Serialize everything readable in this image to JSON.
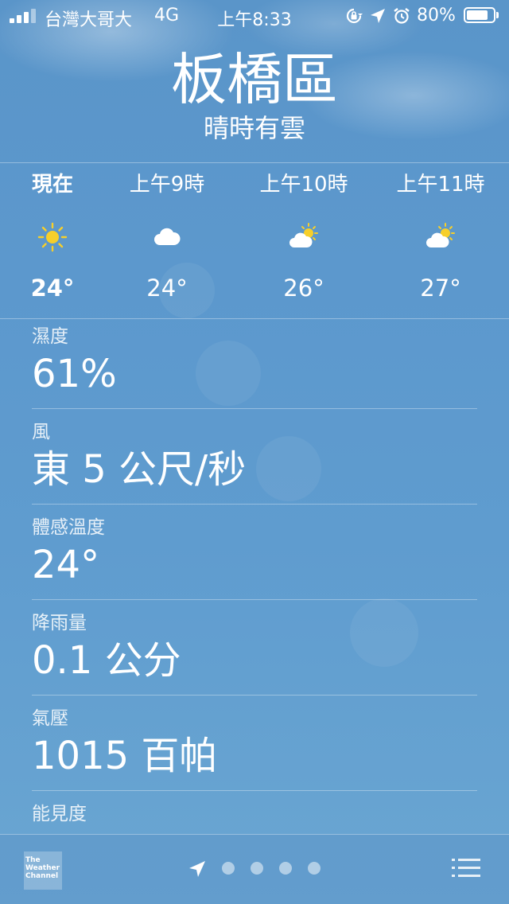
{
  "status_bar": {
    "carrier": "台灣大哥大",
    "network": "4G",
    "time": "上午8:33",
    "battery_percent": "80%",
    "battery_level": 0.8
  },
  "header": {
    "city": "板橋區",
    "condition": "晴時有雲"
  },
  "hourly": [
    {
      "label": "現在",
      "icon": "sun-icon",
      "temp": "24°"
    },
    {
      "label": "上午9時",
      "icon": "cloud-icon",
      "temp": "24°"
    },
    {
      "label": "上午10時",
      "icon": "partly-sunny-icon",
      "temp": "26°"
    },
    {
      "label": "上午11時",
      "icon": "partly-sunny-icon",
      "temp": "27°"
    }
  ],
  "details": [
    {
      "label": "濕度",
      "value": "61%"
    },
    {
      "label": "風",
      "value": "東 5 公尺/秒"
    },
    {
      "label": "體感溫度",
      "value": "24°"
    },
    {
      "label": "降雨量",
      "value": "0.1 公分"
    },
    {
      "label": "氣壓",
      "value": "1015 百帕"
    },
    {
      "label": "能見度",
      "value": ""
    }
  ],
  "bottom_bar": {
    "logo_lines": [
      "The",
      "Weather",
      "Channel"
    ],
    "page_dots": 4,
    "icons": [
      "location-arrow-icon",
      "list-icon"
    ]
  },
  "colors": {
    "background": "#5c98cd",
    "sun": "#f6cf2b",
    "text": "#ffffff"
  }
}
